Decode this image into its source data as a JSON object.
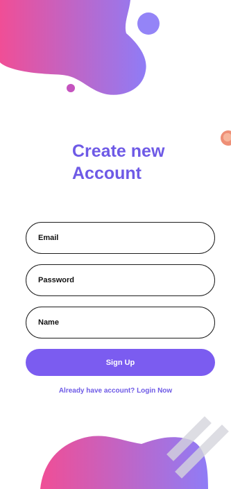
{
  "title": {
    "line1": "Create new",
    "line2": "Account"
  },
  "form": {
    "email_placeholder": "Email",
    "password_placeholder": "Password",
    "name_placeholder": "Name"
  },
  "signup_label": "Sign Up",
  "login_link": "Already have account? Login Now",
  "colors": {
    "accent": "#7b5cf0",
    "title": "#6e5ae6",
    "blob_gradient_start": "#f04e96",
    "blob_gradient_end": "#8f7cf6"
  }
}
